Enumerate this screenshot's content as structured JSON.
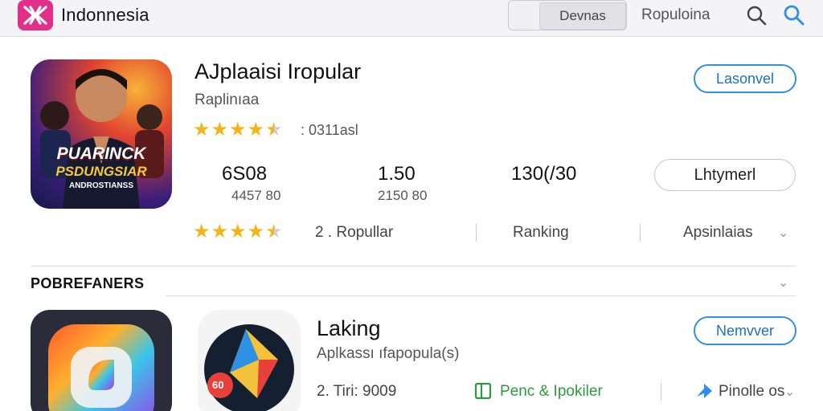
{
  "header": {
    "app_title": "Indonnesia",
    "segment_label": "Devnas",
    "sort_label": "Ropuloina"
  },
  "featured": {
    "title": "AJplaaisi Iropular",
    "subtitle": "Raplinıaa",
    "rating_stars": 4.5,
    "rating_text": ": 0311asl",
    "tile_caption_1": "PUARINCK",
    "tile_caption_2": "PSDUNGSIAR",
    "tile_caption_3": "ANDROSTIANSS",
    "top_button": "Lasonvel",
    "stats": [
      {
        "value": "6S08",
        "sub": "4457 80"
      },
      {
        "value": "1.50",
        "sub": "2150 80"
      },
      {
        "value": "130(/30",
        "sub": ""
      }
    ],
    "install_button": "Lhtymerl",
    "second_rating_stars": 4.5,
    "meta_popular": "2 . Ropullar",
    "meta_ranking": "Ranking",
    "meta_apps": "Apsinlaias"
  },
  "section": {
    "title": "POBREFANERS"
  },
  "second_app": {
    "title": "Laking",
    "subtitle": "Aplkassı ıfapopula(s)",
    "button": "Nemvver",
    "tile_badge": "60",
    "meta_time": "2. Tiri: 9009",
    "meta_feature": "Penc & Ipokiler",
    "meta_link": "Pinolle os"
  },
  "colors": {
    "accent_blue": "#2f8fe3",
    "brand_pink": "#e0308a",
    "star_gold": "#f2b418",
    "feature_green": "#2e9a3f"
  }
}
